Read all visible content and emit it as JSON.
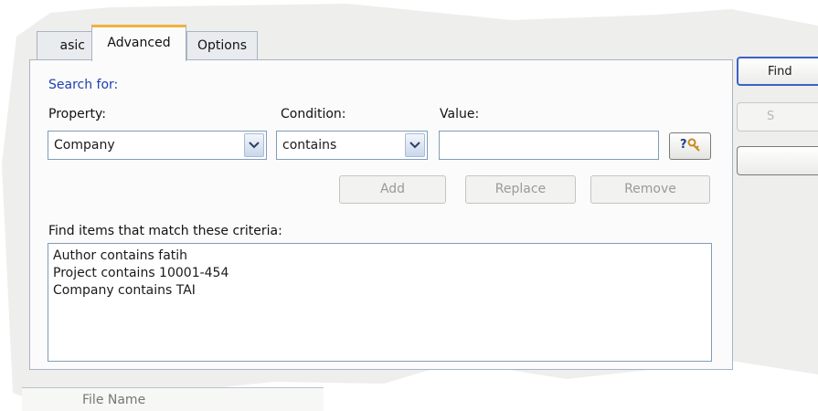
{
  "tabs": {
    "basic": "asic",
    "advanced": "Advanced",
    "options": "Options"
  },
  "search_for": "Search for:",
  "property": {
    "label": "Property:",
    "value": "Company"
  },
  "condition": {
    "label": "Condition:",
    "value": "contains"
  },
  "value_field": {
    "label": "Value:",
    "value": ""
  },
  "browse_icon_text": "?☘",
  "buttons": {
    "add": "Add",
    "replace": "Replace",
    "remove": "Remove"
  },
  "criteria": {
    "label": "Find items that match these criteria:",
    "items": [
      "Author contains fatih",
      "Project contains 10001-454",
      "Company contains TAI"
    ]
  },
  "right_buttons": {
    "find": "Find",
    "second": "S",
    "third": ""
  },
  "results_header": "File Name"
}
